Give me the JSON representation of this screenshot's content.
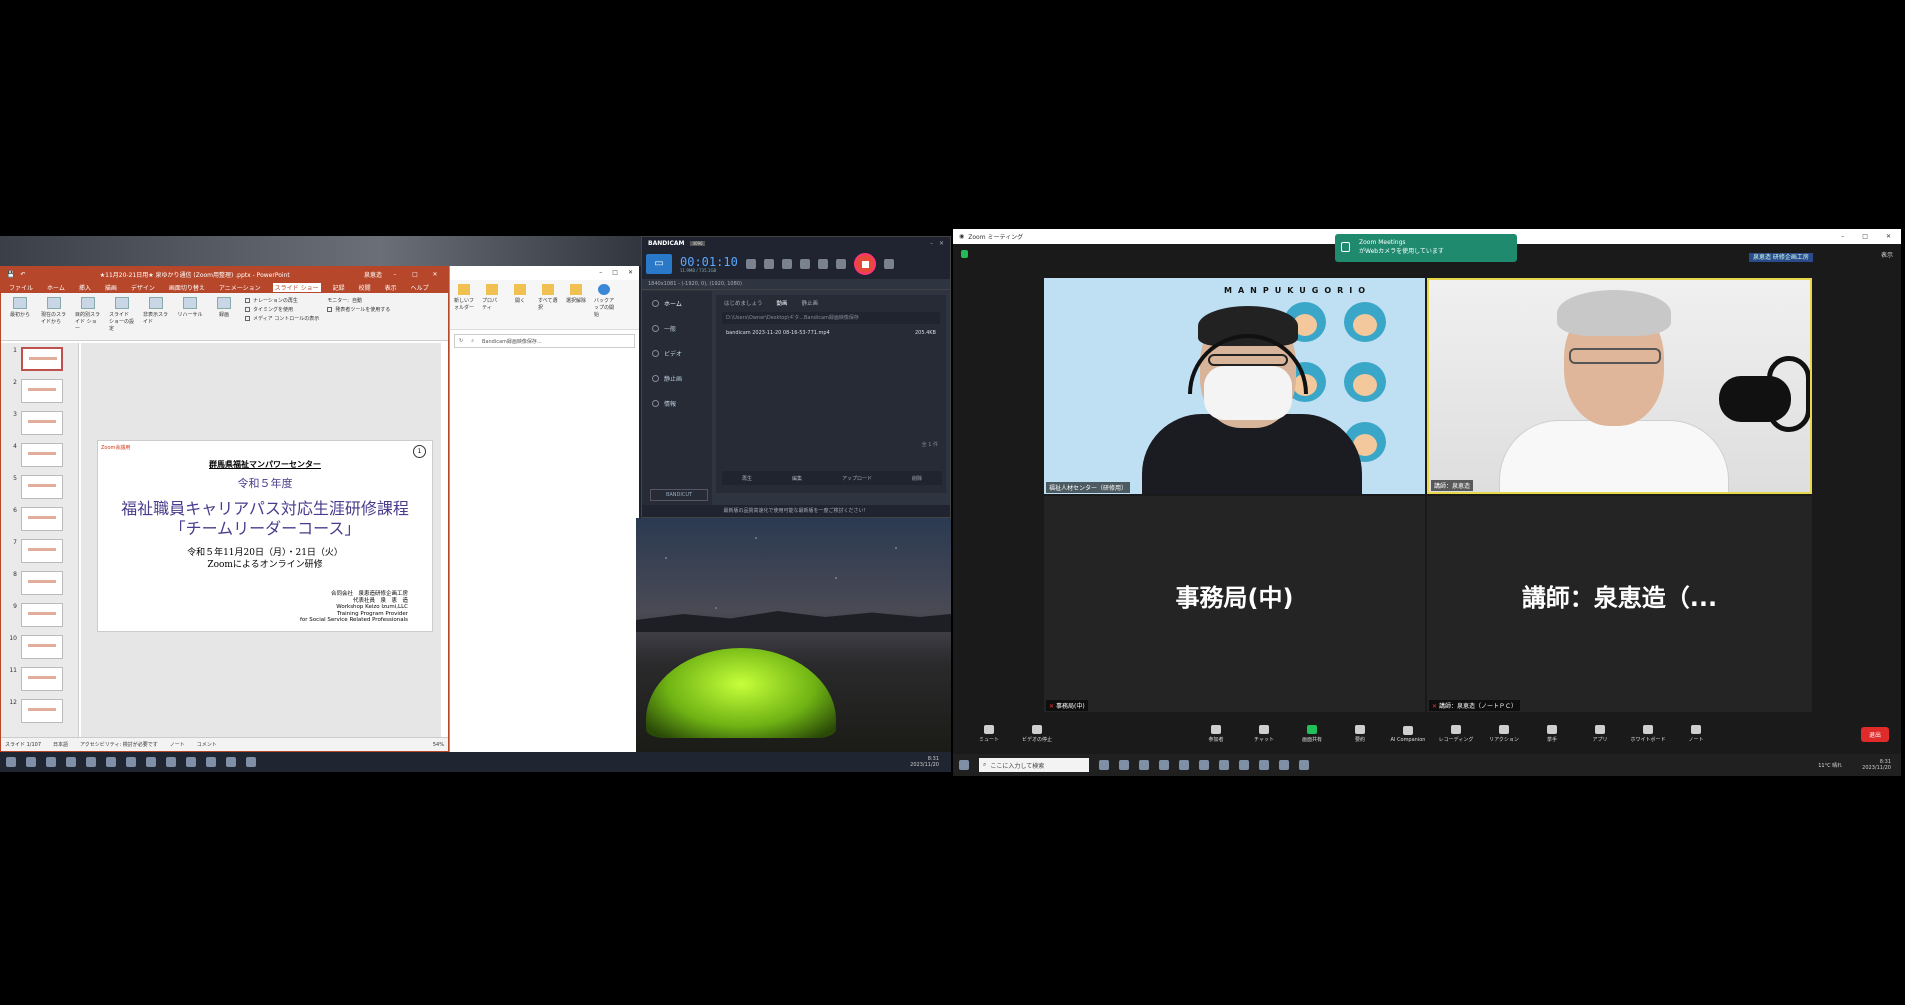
{
  "ppt": {
    "title": "★11月20-21日用★ 泉ゆかり通信 (Zoom用整理) .pptx - PowerPoint",
    "user": "泉恵造",
    "tabs": [
      "ファイル",
      "ホーム",
      "挿入",
      "描画",
      "デザイン",
      "画面切り替え",
      "アニメーション",
      "スライド ショー",
      "記録",
      "校閲",
      "表示",
      "ヘルプ"
    ],
    "active_tab": "スライド ショー",
    "ribbon": {
      "from_start": "最初から",
      "from_current": "現在のスライドから",
      "online": "オンライン プレゼン",
      "custom": "目的別スライド ショー",
      "setup": "スライド ショーの設定",
      "hide": "非表示スライド",
      "rehearse": "リハーサル",
      "record": "録画",
      "narration": "ナレーションの再生",
      "timing": "タイミングを使用",
      "media": "メディア コントロールの表示",
      "monitor_label": "モニター:",
      "monitor_value": "自動",
      "presenter": "発表者ツールを使用する",
      "group_start": "スライド ショーの開始",
      "group_setup": "設定",
      "group_monitor": "モニター"
    },
    "slide_numbers": [
      "1",
      "2",
      "3",
      "4",
      "5",
      "6",
      "7",
      "8",
      "9",
      "10",
      "11",
      "12"
    ],
    "slide": {
      "corner": "Zoom会議用",
      "page_num": "1",
      "org": "群馬県福祉マンパワーセンター",
      "year": "令和５年度",
      "title1": "福祉職員キャリアパス対応生涯研修課程",
      "title2": "「チームリーダーコース」",
      "date": "令和５年11月20日（月）・21日（火）",
      "venue": "Zoomによるオンライン研修",
      "company": "合同会社　泉恵造研修企画工房",
      "rep": "代表社員　泉　恵　造",
      "en1": "Workshop Keizo Izumi,LLC",
      "en2": "Training Program Provider",
      "en3": "for Social Service Related Professionals"
    },
    "status": {
      "slide_count": "スライド 1/107",
      "lang": "日本語",
      "access": "アクセシビリティ: 検討が必要です",
      "notes": "ノート",
      "comments": "コメント",
      "zoom": "54%"
    }
  },
  "explorer": {
    "ribbon": [
      "新しいフォルダー",
      "プロパティ",
      "開く",
      "すべて選択",
      "選択解除",
      "選択の切り替え",
      "バックアップの開始"
    ],
    "groups": [
      "新規",
      "開く",
      "選択",
      "バックアップ"
    ],
    "search_placeholder": "Bandicam録画映像保存..."
  },
  "bandicam": {
    "logo": "BANDICAM",
    "badge": "4096",
    "timer": "00:01:10",
    "size": "11.9MB / 735.1GB",
    "resolution": "1840x1081 - (-1920, 0), (1920, 1080)",
    "nav": [
      "ホーム",
      "一般",
      "ビデオ",
      "静止画",
      "情報"
    ],
    "tabs": [
      "はじめましょう",
      "動画",
      "静止画"
    ],
    "path": "D:\\Users\\Owner\\Desktop\\ギタ...Bandicam録画映像保存",
    "file_name": "bandicam 2023-11-20 08-16-53-771.mp4",
    "file_size": "205.4KB",
    "pager": "全 1 件",
    "actions": [
      "再生",
      "編集",
      "アップロード",
      "削除"
    ],
    "cut_label": "BANDICUT",
    "footer": "最新版の品質高速化で使用可能な最新版を一度ご検討ください！"
  },
  "left_clock": {
    "time": "8:31",
    "date": "2023/11/20"
  },
  "zoom": {
    "window_title": "Zoom ミーティング",
    "view": "表示",
    "toast_title": "Zoom Meetings",
    "toast_body": "がWebカメラを使用しています",
    "talk_tag": "泉恵造 研修企画工房",
    "tiles": {
      "mask_brand": "MANPUKUGORIO",
      "mask_name": "福祉人材センター（研修用）",
      "lect_name": "講師：泉恵造",
      "jim_big": "事務局(中)",
      "jim_name": "事務局(中)",
      "kosh_big": "講師：泉恵造（...",
      "kosh_name": "講師：泉恵造（ノートＰＣ）"
    },
    "toolbar": {
      "mute": "ミュート",
      "video": "ビデオの停止",
      "participants": "参加者",
      "participants_count": "4",
      "chat": "チャット",
      "share": "画面共有",
      "record": "要約",
      "ai": "AI Companion",
      "recording": "レコーディング",
      "reactions": "リアクション",
      "raise": "挙手",
      "apps": "アプリ",
      "whiteboard": "ホワイトボード",
      "notes": "ノート",
      "leave": "退出"
    },
    "taskbar": {
      "search": "ここに入力して検索",
      "weather": "11°C 晴れ",
      "time": "8:31",
      "date": "2023/11/20"
    }
  }
}
